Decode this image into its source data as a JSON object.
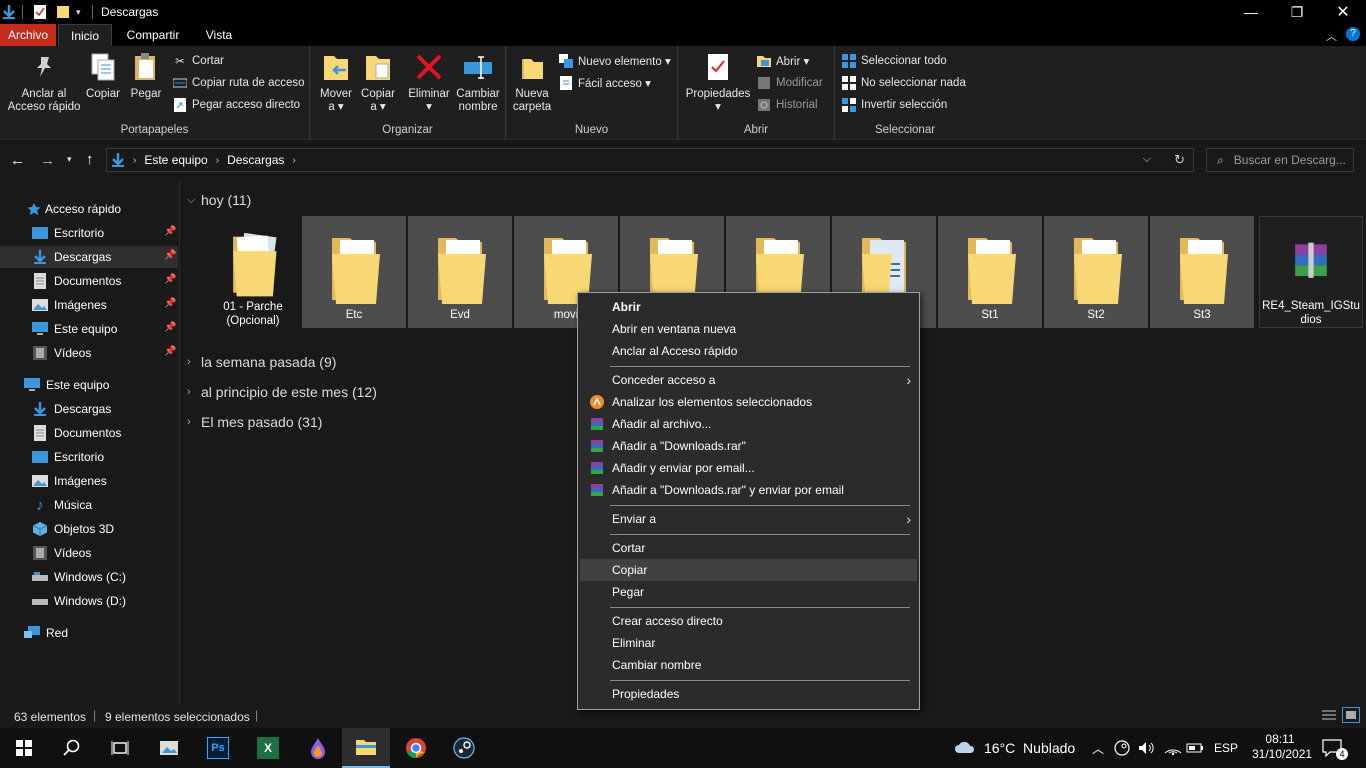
{
  "window": {
    "title": "Descargas"
  },
  "ribbon_tabs": {
    "archivo": "Archivo",
    "inicio": "Inicio",
    "compartir": "Compartir",
    "vista": "Vista"
  },
  "ribbon": {
    "portapapeles": {
      "label": "Portapapeles",
      "anclar_1": "Anclar al",
      "anclar_2": "Acceso rápido",
      "copiar": "Copiar",
      "pegar": "Pegar",
      "cortar": "Cortar",
      "copiar_ruta": "Copiar ruta de acceso",
      "pegar_acceso": "Pegar acceso directo"
    },
    "organizar": {
      "label": "Organizar",
      "mover_1": "Mover",
      "mover_2": "a ▾",
      "copiar_1": "Copiar",
      "copiar_2": "a ▾",
      "eliminar_1": "Eliminar",
      "eliminar_2": "▾",
      "cambiar_1": "Cambiar",
      "cambiar_2": "nombre"
    },
    "nuevo": {
      "label": "Nuevo",
      "carpeta_1": "Nueva",
      "carpeta_2": "carpeta",
      "elemento": "Nuevo elemento ▾",
      "facil": "Fácil acceso ▾"
    },
    "abrir": {
      "label": "Abrir",
      "propiedades_1": "Propiedades",
      "propiedades_2": "▾",
      "abrir": "Abrir ▾",
      "modificar": "Modificar",
      "historial": "Historial"
    },
    "seleccionar": {
      "label": "Seleccionar",
      "todo": "Seleccionar todo",
      "nada": "No seleccionar nada",
      "invertir": "Invertir selección"
    }
  },
  "address": {
    "crumb1": "Este equipo",
    "crumb2": "Descargas",
    "search_placeholder": "Buscar en Descarg..."
  },
  "sidebar": {
    "quick_access": "Acceso rápido",
    "quick_items": [
      "Escritorio",
      "Descargas",
      "Documentos",
      "Imágenes",
      "Este equipo",
      "Vídeos"
    ],
    "this_pc": "Este equipo",
    "pc_items": [
      "Descargas",
      "Documentos",
      "Escritorio",
      "Imágenes",
      "Música",
      "Objetos 3D",
      "Vídeos",
      "Windows (C:)",
      "Windows (D:)"
    ],
    "network": "Red"
  },
  "groups": {
    "hoy": "hoy (11)",
    "semana": "la semana pasada (9)",
    "principio": "al principio de este mes (12)",
    "mes": "El mes pasado (31)"
  },
  "tiles": [
    "01 - Parche (Opcional)",
    "Etc",
    "Evd",
    "movi",
    "",
    "",
    "",
    "St1",
    "St2",
    "St3",
    "RE4_Steam_IGStudios"
  ],
  "context_menu": {
    "abrir": "Abrir",
    "abrir_nueva": "Abrir en ventana nueva",
    "anclar": "Anclar al Acceso rápido",
    "conceder": "Conceder acceso a",
    "analizar": "Analizar los elementos seleccionados",
    "anadir_archivo": "Añadir al archivo...",
    "anadir_rar": "Añadir a \"Downloads.rar\"",
    "anadir_email": "Añadir y enviar por email...",
    "anadir_rar_email": "Añadir a \"Downloads.rar\" y enviar por email",
    "enviar": "Enviar a",
    "cortar": "Cortar",
    "copiar": "Copiar",
    "pegar": "Pegar",
    "crear_acceso": "Crear acceso directo",
    "eliminar": "Eliminar",
    "cambiar_nombre": "Cambiar nombre",
    "propiedades": "Propiedades"
  },
  "status": {
    "count": "63 elementos",
    "selected": "9 elementos seleccionados"
  },
  "taskbar": {
    "weather": "16°C  Nublado",
    "lang": "ESP",
    "time": "08:11",
    "date": "31/10/2021",
    "notifications": "4"
  },
  "colors": {
    "accent": "#0078d7",
    "archivo_tab": "#c42b1c",
    "folder": "#f8d775"
  }
}
